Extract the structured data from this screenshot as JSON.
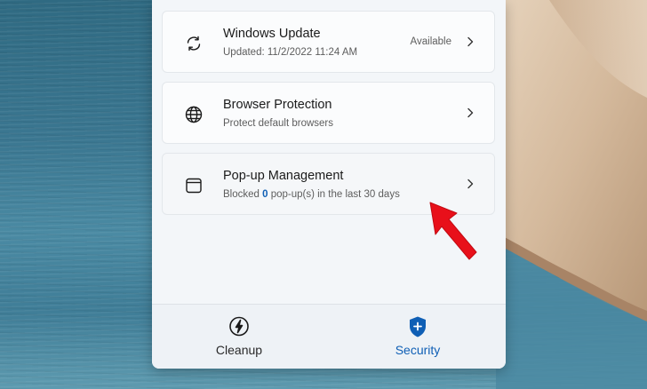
{
  "colors": {
    "accent": "#0f5fb5",
    "panel_bg": "#f3f6f9",
    "card_bg": "#fbfcfd",
    "arrow": "#e8101a"
  },
  "cards": [
    {
      "icon": "sync-icon",
      "title": "Windows Update",
      "subtitle": "Updated: 11/2/2022 11:24 AM",
      "status": "Available"
    },
    {
      "icon": "globe-icon",
      "title": "Browser Protection",
      "subtitle": "Protect default browsers"
    },
    {
      "icon": "window-icon",
      "title": "Pop-up Management",
      "subtitle_prefix": "Blocked ",
      "blocked_count": "0",
      "subtitle_suffix": " pop-up(s) in the last 30 days"
    }
  ],
  "nav": {
    "cleanup": {
      "icon": "lightning-icon",
      "label": "Cleanup"
    },
    "security": {
      "icon": "shield-plus-icon",
      "label": "Security"
    }
  }
}
